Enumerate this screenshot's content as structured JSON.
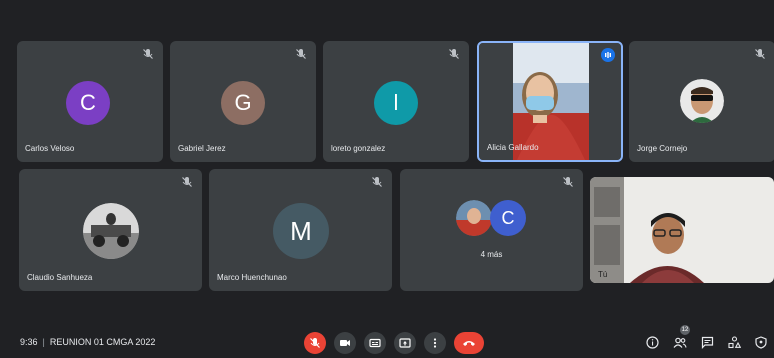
{
  "participants": {
    "carlos": {
      "initial": "C",
      "name": "Carlos Veloso",
      "color": "#7b3fc4"
    },
    "gabriel": {
      "initial": "G",
      "name": "Gabriel Jerez",
      "color": "#8d6e63"
    },
    "loreto": {
      "initial": "l",
      "name": "loreto gonzalez",
      "color": "#0f9aa8"
    },
    "alicia": {
      "name": "Alicia Gallardo"
    },
    "jorge": {
      "name": "Jorge Cornejo"
    },
    "claudio": {
      "name": "Claudio Sanhueza"
    },
    "marco": {
      "initial": "M",
      "name": "Marco Huenchunao",
      "color": "#455a64"
    },
    "more": {
      "initial": "C",
      "label": "4 más",
      "color": "#3f5fcf"
    },
    "self": {
      "name": "Tú"
    }
  },
  "bottombar": {
    "time": "9:36",
    "meeting_title": "REUNION 01 CMGA 2022",
    "participant_count": "12"
  },
  "icons": {
    "mic_off": "mic-off-icon",
    "camera": "camera-icon",
    "captions": "captions-icon",
    "present": "present-icon",
    "more": "more-options-icon",
    "end_call": "end-call-icon",
    "info": "info-icon",
    "people": "people-icon",
    "chat": "chat-icon",
    "activities": "activities-icon",
    "host_controls": "host-controls-icon"
  },
  "colors": {
    "background": "#202124",
    "tile": "#3c4043",
    "accent": "#1a73e8",
    "danger": "#ea4335"
  }
}
